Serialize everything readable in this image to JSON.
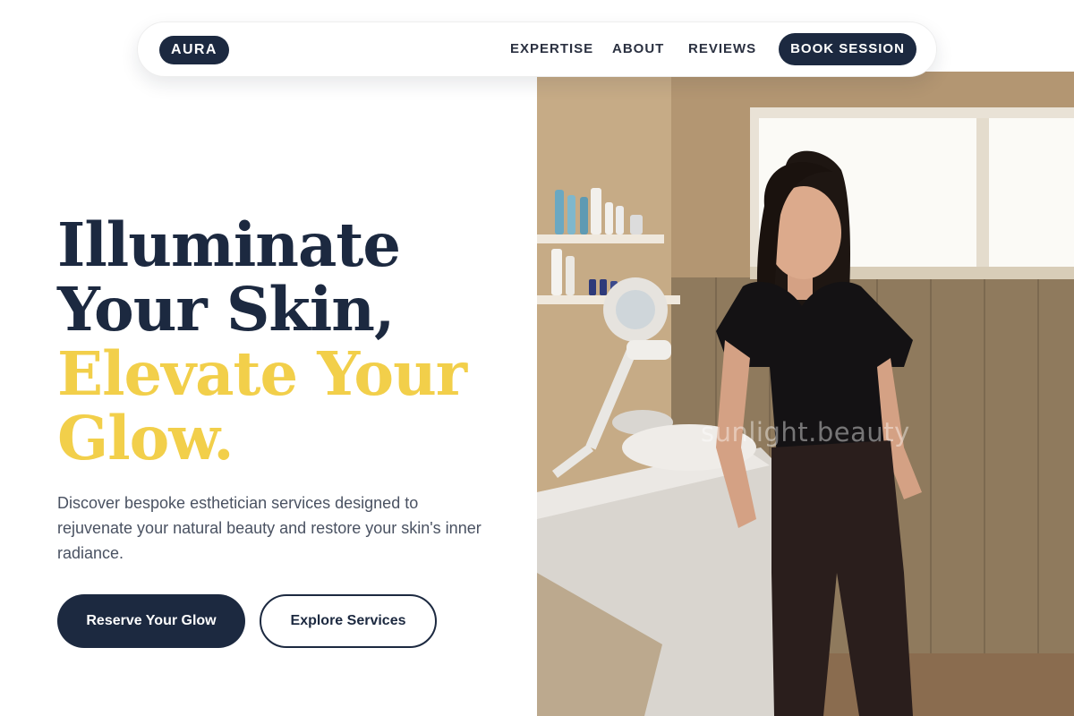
{
  "nav": {
    "logo": "AURA",
    "links": [
      "EXPERTISE",
      "ABOUT",
      "REVIEWS"
    ],
    "cta": "BOOK SESSION"
  },
  "hero": {
    "headline_dark": [
      "Illuminate",
      "Your Skin,"
    ],
    "headline_accent": [
      "Elevate Your",
      "Glow."
    ],
    "subtext": "Discover bespoke esthetician services designed to rejuvenate your natural beauty and restore your skin's inner radiance.",
    "primary_cta": "Reserve Your Glow",
    "secondary_cta": "Explore Services",
    "image_watermark": "sunlight.beauty"
  },
  "colors": {
    "navy": "#1c2940",
    "gold": "#f2cf4a",
    "body_text": "#4a5262",
    "background": "#ffffff"
  }
}
